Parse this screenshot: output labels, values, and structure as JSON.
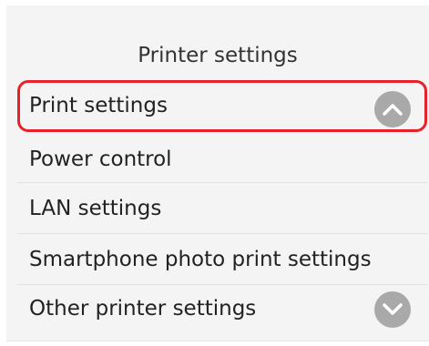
{
  "header": {
    "title": "Printer settings"
  },
  "menu": {
    "items": [
      {
        "label": "Print settings",
        "selected": true
      },
      {
        "label": "Power control",
        "selected": false
      },
      {
        "label": "LAN settings",
        "selected": false
      },
      {
        "label": "Smartphone photo print settings",
        "selected": false
      },
      {
        "label": "Other printer settings",
        "selected": false
      }
    ]
  },
  "scroll": {
    "up_icon": "chevron-up-icon",
    "down_icon": "chevron-down-icon"
  },
  "colors": {
    "selection_border": "#e8202a",
    "scroll_button": "#a9a9a9",
    "screen_background": "#f4f4f4"
  }
}
